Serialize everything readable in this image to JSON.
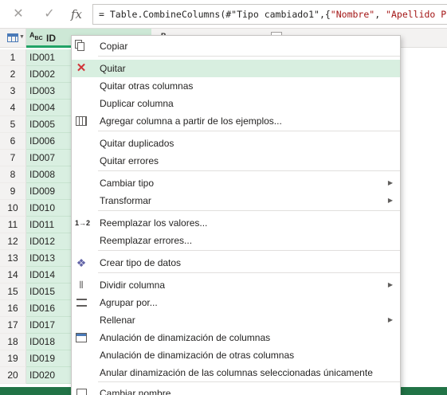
{
  "formula_bar": {
    "cancel_glyph": "✕",
    "ok_glyph": "✓",
    "fx_label": "fx",
    "formula_prefix": "= Table.CombineColumns(#\"Tipo cambiado1\",{",
    "formula_str1": "\"Nombre\"",
    "formula_mid": ", ",
    "formula_str2": "\"Apellido Pate"
  },
  "grid": {
    "id_column": {
      "type_top": "A",
      "type_sub_b": "B",
      "type_sub_c": "C",
      "label": "ID"
    },
    "row_numbers": [
      "1",
      "2",
      "3",
      "4",
      "5",
      "6",
      "7",
      "8",
      "9",
      "10",
      "11",
      "12",
      "13",
      "14",
      "15",
      "16",
      "17",
      "18",
      "19",
      "20"
    ],
    "id_values": [
      "ID001",
      "ID002",
      "ID003",
      "ID004",
      "ID005",
      "ID006",
      "ID007",
      "ID008",
      "ID009",
      "ID010",
      "ID011",
      "ID012",
      "ID013",
      "ID014",
      "ID015",
      "ID016",
      "ID017",
      "ID018",
      "ID019",
      "ID020"
    ]
  },
  "context_menu": {
    "items": [
      {
        "label": "Copiar",
        "icon": "copy-icon"
      },
      {
        "label": "Quitar",
        "icon": "remove-x-icon",
        "highlighted": true
      },
      {
        "label": "Quitar otras columnas"
      },
      {
        "label": "Duplicar columna"
      },
      {
        "label": "Agregar columna a partir de los ejemplos...",
        "icon": "column-from-examples-icon"
      },
      {
        "label": "Quitar duplicados"
      },
      {
        "label": "Quitar errores"
      },
      {
        "label": "Cambiar tipo",
        "submenu": true
      },
      {
        "label": "Transformar",
        "submenu": true
      },
      {
        "label": "Reemplazar los valores...",
        "icon": "replace-values-icon",
        "icon_glyph": "1→2"
      },
      {
        "label": "Reemplazar errores..."
      },
      {
        "label": "Crear tipo de datos",
        "icon": "data-type-icon"
      },
      {
        "label": "Dividir columna",
        "icon": "split-column-icon",
        "submenu": true
      },
      {
        "label": "Agrupar por...",
        "icon": "group-by-icon"
      },
      {
        "label": "Rellenar",
        "submenu": true
      },
      {
        "label": "Anulación de dinamización de columnas",
        "icon": "unpivot-icon"
      },
      {
        "label": "Anulación de dinamización de otras columnas"
      },
      {
        "label": "Anular dinamización de las columnas seleccionadas únicamente"
      },
      {
        "label": "Cambiar nombre...",
        "icon": "rename-icon"
      }
    ]
  },
  "colors": {
    "accent_green": "#21a366",
    "selected_column_bg": "#d9efe1",
    "menu_highlight": "#d8efe0",
    "remove_red": "#d13438",
    "status_bar": "#217346"
  }
}
